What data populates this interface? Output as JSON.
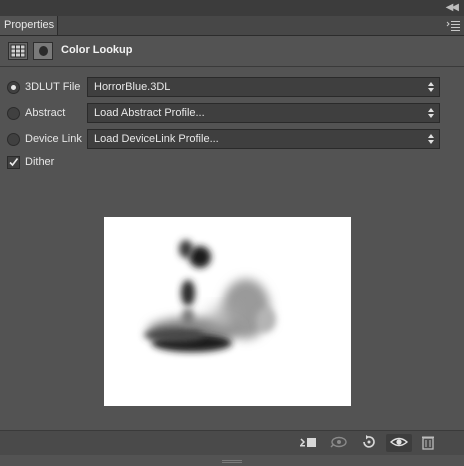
{
  "panel": {
    "tab_label": "Properties",
    "title": "Color Lookup"
  },
  "options": [
    {
      "label": "3DLUT File",
      "value": "HorrorBlue.3DL",
      "selected": true
    },
    {
      "label": "Abstract",
      "value": "Load Abstract Profile...",
      "selected": false
    },
    {
      "label": "Device Link",
      "value": "Load DeviceLink Profile...",
      "selected": false
    }
  ],
  "dither": {
    "label": "Dither",
    "checked": true
  },
  "icons": {
    "collapse": "double-chevron-left-icon",
    "panel_menu": "panel-menu-icon",
    "adjustment": "adjustment-grid-icon",
    "mask": "layer-mask-icon",
    "clip": "clip-to-layer-icon",
    "view_previous": "view-previous-state-icon",
    "reset": "reset-icon",
    "visibility": "eye-icon",
    "delete": "trash-icon"
  },
  "colors": {
    "panel_bg": "#535353",
    "dark_bg": "#3c3c3c",
    "control_bg": "#3f3f3f",
    "text": "#e6e6e6"
  }
}
